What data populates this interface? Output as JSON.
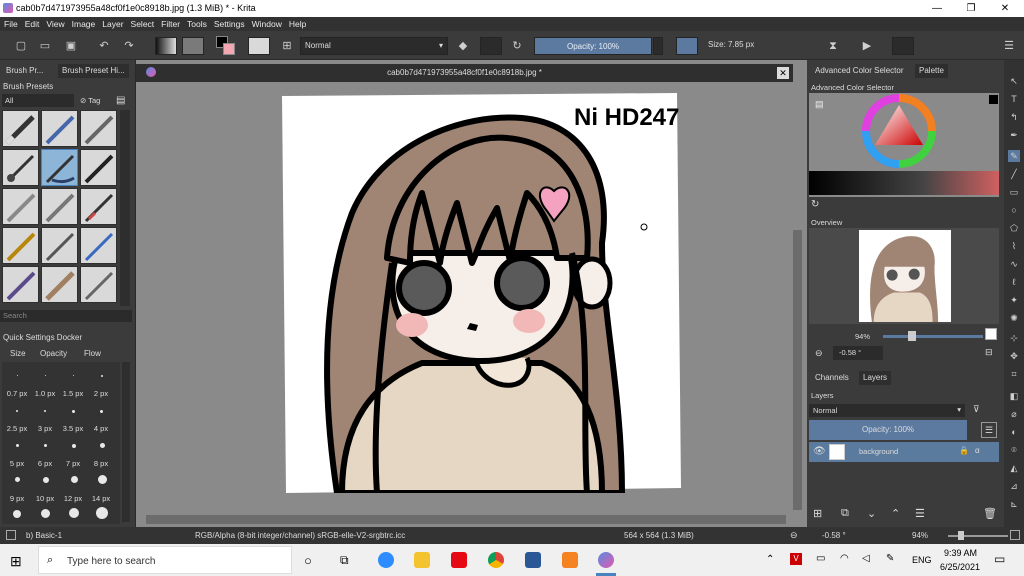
{
  "window": {
    "title": "cab0b7d471973955a48cf0f1e0c8918b.jpg (1.3 MiB)  * - Krita",
    "controls": [
      "—",
      "❐",
      "✕"
    ]
  },
  "menu": [
    "File",
    "Edit",
    "View",
    "Image",
    "Layer",
    "Select",
    "Filter",
    "Tools",
    "Settings",
    "Window",
    "Help"
  ],
  "toolbar": {
    "blend_mode": "Normal",
    "opacity": "Opacity: 100%",
    "size": "Size: 7.85 px"
  },
  "brush_presets": {
    "tabs": [
      "Brush Pr...",
      "Brush Preset Hi..."
    ],
    "title": "Brush Presets",
    "filter": "All",
    "tag": "Tag",
    "search_placeholder": "Search"
  },
  "quick_settings": {
    "title": "Quick Settings Docker",
    "tabs": [
      "Size",
      "Opacity",
      "Flow"
    ],
    "sizes": [
      "0.7 px",
      "1.0 px",
      "1.5 px",
      "2 px",
      "2.5 px",
      "3 px",
      "3.5 px",
      "4 px",
      "5 px",
      "6 px",
      "7 px",
      "8 px",
      "9 px",
      "10 px",
      "12 px",
      "14 px"
    ]
  },
  "document": {
    "tab_title": "cab0b7d471973955a48cf0f1e0c8918b.jpg *",
    "signature": "Ni HD247"
  },
  "color_selector": {
    "tabs": [
      "Advanced Color Selector",
      "Palette"
    ],
    "title": "Advanced Color Selector"
  },
  "overview": {
    "title": "Overview",
    "zoom": "94%",
    "rotation": "-0.58 °"
  },
  "layers": {
    "tabs": [
      "Channels",
      "Layers"
    ],
    "title": "Layers",
    "blend_mode": "Normal",
    "opacity": "Opacity:  100%",
    "items": [
      {
        "name": "background"
      }
    ]
  },
  "status": {
    "brush": "b) Basic-1",
    "colorspace": "RGB/Alpha (8-bit integer/channel)  sRGB-elle-V2-srgbtrc.icc",
    "dimensions": "564 x 564 (1.3 MiB)",
    "rotation": "-0.58 °",
    "zoom": "94%"
  },
  "taskbar": {
    "search_placeholder": "Type here to search",
    "lang": "ENG",
    "time": "9:39 AM",
    "date": "6/25/2021"
  },
  "colors": {
    "hair": "#a08474",
    "sweater": "#e6d6c4",
    "skin": "#f6eee8",
    "blush": "#f2b8b8",
    "eyes": "#5a5a5a",
    "heart": "#f4a2c0",
    "accent": "#5c7aa0",
    "canvas_bg": "#8a8a8a"
  }
}
